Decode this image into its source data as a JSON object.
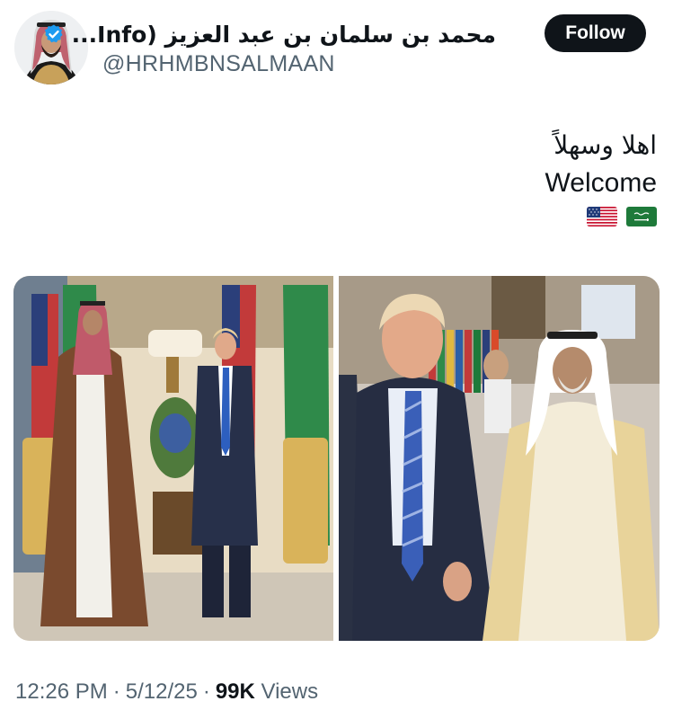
{
  "author": {
    "display_name": "محمد بن سلمان بن عبد العزيز (Info...",
    "handle": "@HRHMBNSALMAAN",
    "verified": true,
    "verified_color": "#1d9bf0",
    "avatar_icon": "profile-photo"
  },
  "actions": {
    "follow_label": "Follow"
  },
  "tweet": {
    "text_ar": "اهلا وسهلاً",
    "text_en": "Welcome",
    "flags": [
      "flag-usa",
      "flag-saudi-arabia"
    ]
  },
  "media": {
    "photos": [
      "photo-left",
      "photo-right"
    ]
  },
  "meta": {
    "time": "12:26 PM",
    "date": "5/12/25",
    "views_count": "99K",
    "views_label": "Views",
    "separator": "·"
  }
}
